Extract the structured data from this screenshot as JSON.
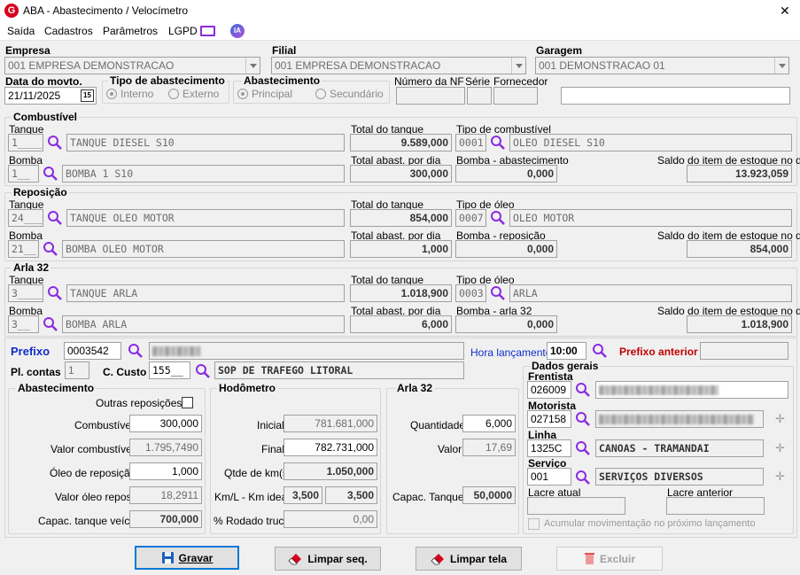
{
  "window": {
    "title": "ABA - Abastecimento / Velocímetro",
    "close": "✕"
  },
  "menu": [
    "Saída",
    "Cadastros",
    "Parâmetros",
    "LGPD"
  ],
  "ia_badge": "IA",
  "header": {
    "empresa_label": "Empresa",
    "empresa_value": "001 EMPRESA DEMONSTRACAO",
    "filial_label": "Filial",
    "filial_value": "001 EMPRESA DEMONSTRACAO",
    "garagem_label": "Garagem",
    "garagem_value": "001 DEMONSTRACAO 01",
    "data_label": "Data do movto.",
    "data_value": "21/11/2025",
    "cal": "15",
    "tipo_label": "Tipo de abastecimento",
    "tipo_opt1": "Interno",
    "tipo_opt2": "Externo",
    "abast_label": "Abastecimento",
    "abast_opt1": "Principal",
    "abast_opt2": "Secundário",
    "nf_label": "Número da NF",
    "serie_label": "Série",
    "fornecedor_label": "Fornecedor"
  },
  "combustivel": {
    "title": "Combustível",
    "tanque_label": "Tanque",
    "tanque_code": "1____",
    "tanque_name": "TANQUE DIESEL S10",
    "total_tanque_label": "Total do tanque",
    "total_tanque": "9.589,000",
    "tipo_label": "Tipo de combustível",
    "tipo_code": "0001",
    "tipo_name": "OLEO DIESEL S10",
    "bomba_label": "Bomba",
    "bomba_code": "1__",
    "bomba_name": "BOMBA 1 S10",
    "total_dia_label": "Total abast. por dia",
    "total_dia": "300,000",
    "bomba_abast_label": "Bomba - abastecimento",
    "bomba_abast": "0,000",
    "saldo_label": "Saldo do item de estoque no dia",
    "saldo": "13.923,059"
  },
  "reposicao": {
    "title": "Reposição",
    "tanque_label": "Tanque",
    "tanque_code": "24___",
    "tanque_name": "TANQUE OLEO MOTOR",
    "total_tanque_label": "Total do tanque",
    "total_tanque": "854,000",
    "tipo_label": "Tipo de óleo",
    "tipo_code": "0007",
    "tipo_name": "OLEO MOTOR",
    "bomba_label": "Bomba",
    "bomba_code": "21__",
    "bomba_name": "BOMBA OLEO MOTOR",
    "total_dia_label": "Total abast. por dia",
    "total_dia": "1,000",
    "bomba_abast_label": "Bomba - reposição",
    "bomba_abast": "0,000",
    "saldo_label": "Saldo do item de estoque no dia",
    "saldo": "854,000"
  },
  "arla": {
    "title": "Arla 32",
    "tanque_label": "Tanque",
    "tanque_code": "3____",
    "tanque_name": "TANQUE ARLA",
    "total_tanque_label": "Total do tanque",
    "total_tanque": "1.018,900",
    "tipo_label": "Tipo de óleo",
    "tipo_code": "0003",
    "tipo_name": "ARLA",
    "bomba_label": "Bomba",
    "bomba_code": "3__",
    "bomba_name": "BOMBA ARLA",
    "total_dia_label": "Total abast. por dia",
    "total_dia": "6,000",
    "bomba_abast_label": "Bomba - arla 32",
    "bomba_abast": "0,000",
    "saldo_label": "Saldo do item de estoque no dia",
    "saldo": "1.018,900"
  },
  "lower": {
    "prefixo_label": "Prefixo",
    "prefixo_value": "0003542",
    "hora_label": "Hora lançamento",
    "hora_value": "10:00",
    "prefixo_ant_label": "Prefixo anterior",
    "pl_contas_label": "Pl. contas",
    "pl_contas_value": "1",
    "ccusto_label": "C. Custo",
    "ccusto_code": "155__",
    "ccusto_name": "SOP DE TRAFEGO LITORAL"
  },
  "abastecimento": {
    "title": "Abastecimento",
    "outras_label": "Outras reposições",
    "comb_label": "Combustível",
    "comb_value": "300,000",
    "valor_comb_label": "Valor combustível",
    "valor_comb_value": "1.795,7490",
    "oleo_label": "Óleo de reposição",
    "oleo_value": "1,000",
    "valor_oleo_label": "Valor óleo repos.",
    "valor_oleo_value": "18,2911",
    "capac_label": "Capac. tanque veíc.",
    "capac_value": "700,000"
  },
  "hodometro": {
    "title": "Hodômetro",
    "inicial_label": "Inicial",
    "inicial_value": "781.681,000",
    "final_label": "Final",
    "final_value": "782.731,000",
    "qtde_label": "Qtde de km(s)",
    "qtde_value": "1.050,000",
    "kml_label": "Km/L - Km ideal",
    "kml_value": "3,500",
    "ideal_value": "3,500",
    "rodado_label": "% Rodado truck",
    "rodado_value": "0,00"
  },
  "arla_box": {
    "title": "Arla 32",
    "qtd_label": "Quantidade",
    "qtd_value": "6,000",
    "valor_label": "Valor",
    "valor_value": "17,69",
    "capac_label": "Capac. Tanque",
    "capac_value": "50,0000"
  },
  "dados": {
    "title": "Dados gerais",
    "frentista_label": "Frentista",
    "frentista_code": "026009",
    "motorista_label": "Motorista",
    "motorista_code": "027158",
    "linha_label": "Linha",
    "linha_code": "1325C",
    "linha_name": "CANOAS - TRAMANDAI",
    "servico_label": "Serviço",
    "servico_code": "001",
    "servico_name": "SERVIÇOS DIVERSOS",
    "lacre_atual_label": "Lacre atual",
    "lacre_ant_label": "Lacre anterior",
    "acumular_label": "Acumular movimentação no próximo lançamento"
  },
  "buttons": {
    "gravar": "Gravar",
    "limpar_seq": "Limpar seq.",
    "limpar_tela": "Limpar tela",
    "excluir": "Excluir"
  },
  "colors": {
    "accent": "#0078d7",
    "prefixo": "#0f2ec7",
    "prefixo_ant": "#c00000",
    "search": "#8a2be2",
    "erase": "#d6001c"
  }
}
